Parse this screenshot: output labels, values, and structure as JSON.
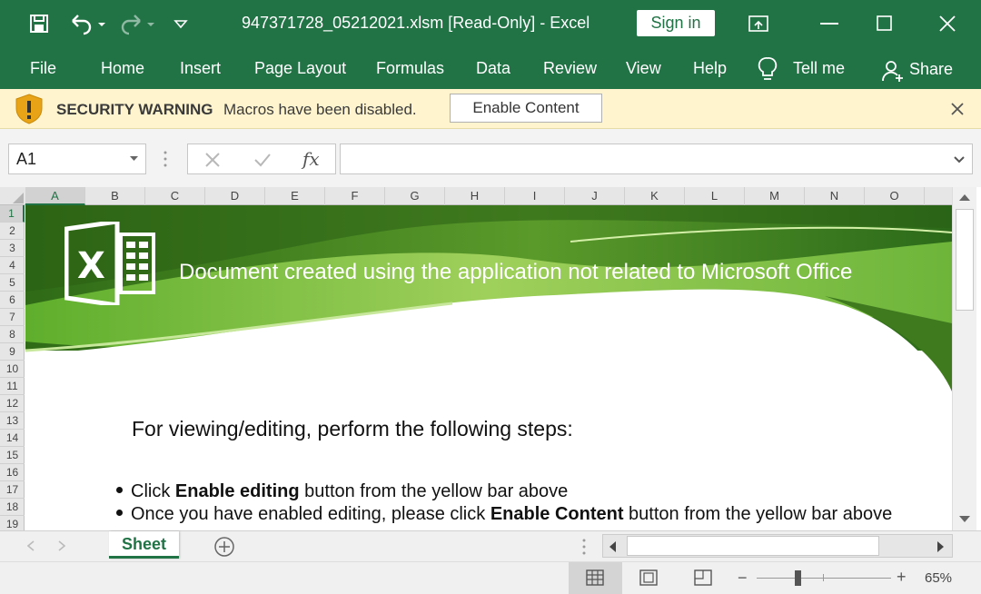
{
  "window": {
    "title": "947371728_05212021.xlsm  [Read-Only]  -  Excel",
    "signin": "Sign in"
  },
  "ribbon": {
    "tabs": [
      "File",
      "Home",
      "Insert",
      "Page Layout",
      "Formulas",
      "Data",
      "Review",
      "View",
      "Help",
      "Tell me",
      "Share"
    ]
  },
  "security": {
    "title": "SECURITY WARNING",
    "message": "Macros have been disabled.",
    "button": "Enable Content"
  },
  "formula": {
    "namebox": "A1",
    "fx": "fx",
    "value": ""
  },
  "grid": {
    "columns": [
      "A",
      "B",
      "C",
      "D",
      "E",
      "F",
      "G",
      "H",
      "I",
      "J",
      "K",
      "L",
      "M",
      "N",
      "O"
    ],
    "rows": [
      "1",
      "2",
      "3",
      "4",
      "5",
      "6",
      "7",
      "8",
      "9",
      "10",
      "11",
      "12",
      "13",
      "14",
      "15",
      "16",
      "17",
      "18",
      "19"
    ]
  },
  "content": {
    "banner": "Document created using the application not related to Microsoft Office",
    "heading": "For viewing/editing, perform the following steps:",
    "step1": {
      "pre": "Click ",
      "bold": "Enable editing",
      "post": " button from the yellow bar above"
    },
    "step2": {
      "pre": "Once you have enabled editing, please click ",
      "bold": "Enable Content",
      "post": " button from the yellow bar above"
    }
  },
  "sheets": {
    "active": "Sheet"
  },
  "status": {
    "zoom": "65%"
  },
  "colors": {
    "excel_green": "#217346",
    "warning_bg": "#fff4ce"
  }
}
